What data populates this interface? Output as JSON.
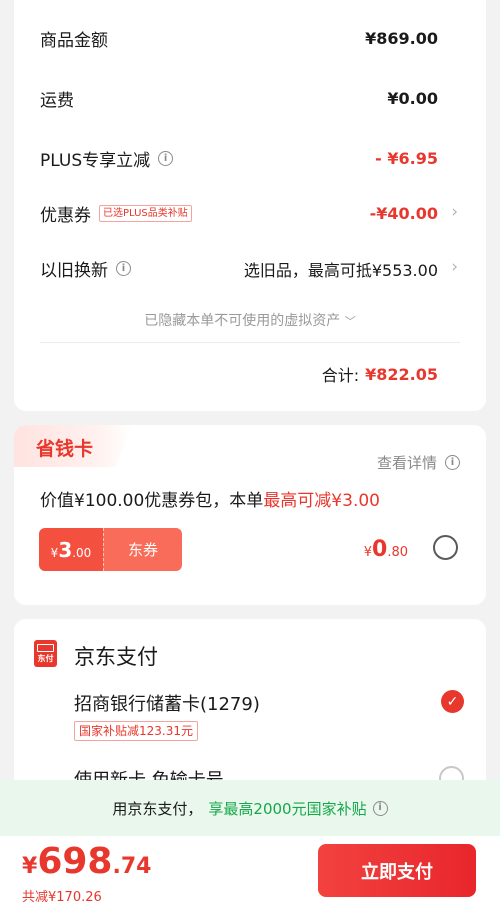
{
  "summary": {
    "goods_label": "商品金额",
    "goods_value": "¥869.00",
    "shipping_label": "运费",
    "shipping_value": "¥0.00",
    "plus_label": "PLUS专享立减",
    "plus_value": "- ¥6.95",
    "coupon_label": "优惠券",
    "coupon_tag": "已选PLUS品类补贴",
    "coupon_value": "-¥40.00",
    "tradein_label": "以旧换新",
    "tradein_value": "选旧品，最高可抵¥553.00",
    "hidden_note": "已隐藏本单不可使用的虚拟资产",
    "total_label": "合计:",
    "total_value": "¥822.05"
  },
  "saver": {
    "title": "省钱卡",
    "detail": "查看详情",
    "desc_prefix": "价值¥100.00优惠券包，本单",
    "desc_highlight": "最高可减¥3.00",
    "coupon_currency": "¥",
    "coupon_int": "3",
    "coupon_dec": ".00",
    "coupon_type": "东券",
    "price_currency": "¥",
    "price_int": "0",
    "price_dec": ".80",
    "selected": false
  },
  "payment": {
    "title": "京东支付",
    "icon_text": "东付",
    "bank_name": "招商银行储蓄卡(1279)",
    "bank_tag": "国家补贴减123.31元",
    "bank_selected": true,
    "new_card": "使用新卡 免输卡号",
    "new_card_selected": false
  },
  "banner": {
    "prefix": "用京东支付，",
    "highlight": "享最高2000元国家补贴"
  },
  "bottom": {
    "currency": "¥",
    "amount_int": "698",
    "amount_dec": ".74",
    "saved": "共减¥170.26",
    "pay_button": "立即支付"
  },
  "colors": {
    "accent_red": "#e8372c",
    "subsidy_green": "#14a84a"
  }
}
